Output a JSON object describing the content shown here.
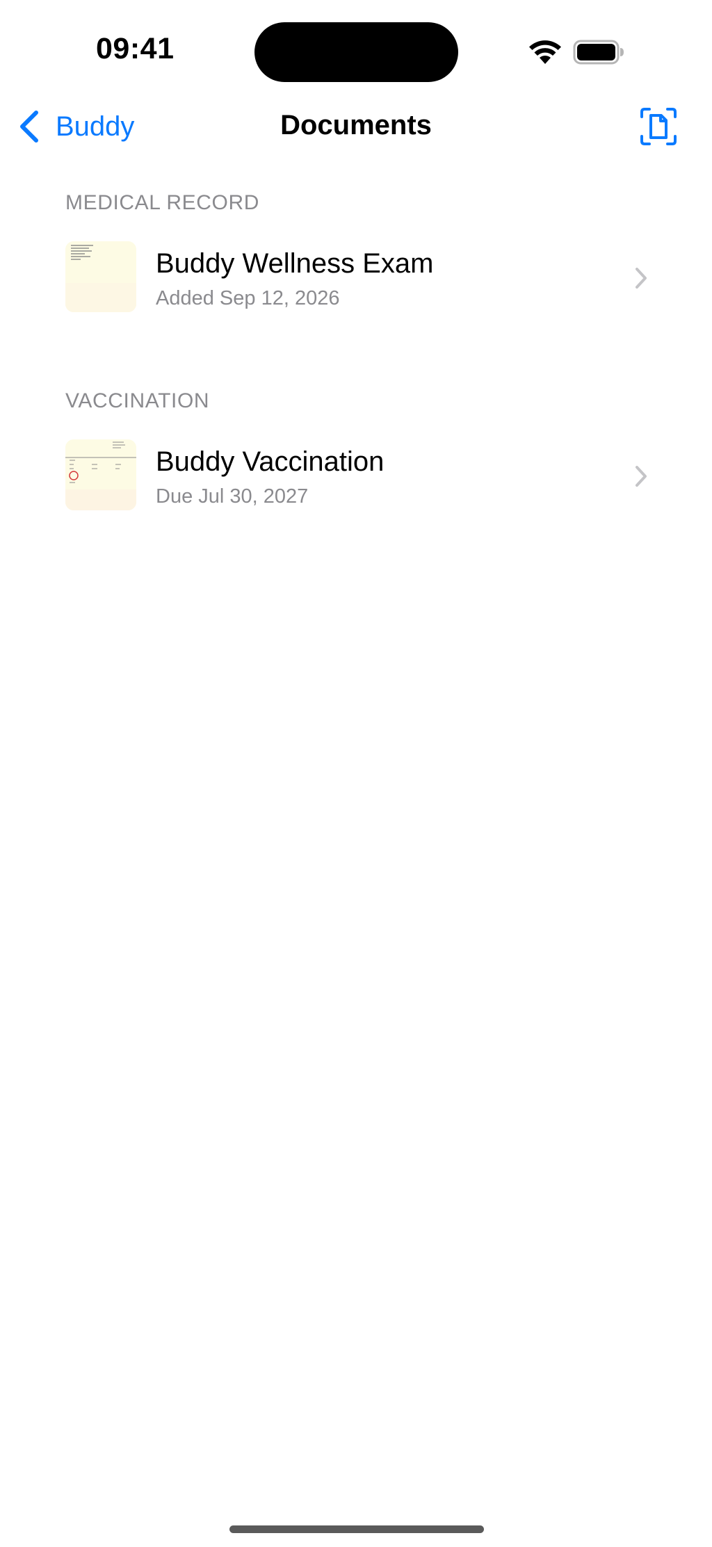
{
  "status_bar": {
    "time": "09:41"
  },
  "nav": {
    "back_label": "Buddy",
    "title": "Documents",
    "accent_color": "#0A7AFF"
  },
  "sections": [
    {
      "header": "MEDICAL RECORD",
      "items": [
        {
          "title": "Buddy Wellness Exam",
          "subtitle": "Added Sep 12, 2026"
        }
      ]
    },
    {
      "header": "VACCINATION",
      "items": [
        {
          "title": "Buddy Vaccination",
          "subtitle": "Due Jul 30, 2027"
        }
      ]
    }
  ],
  "icons": {
    "back": "chevron-left-icon",
    "scan": "document-scan-icon",
    "row_disclosure": "chevron-right-icon",
    "wifi": "wifi-icon",
    "battery": "battery-icon"
  }
}
